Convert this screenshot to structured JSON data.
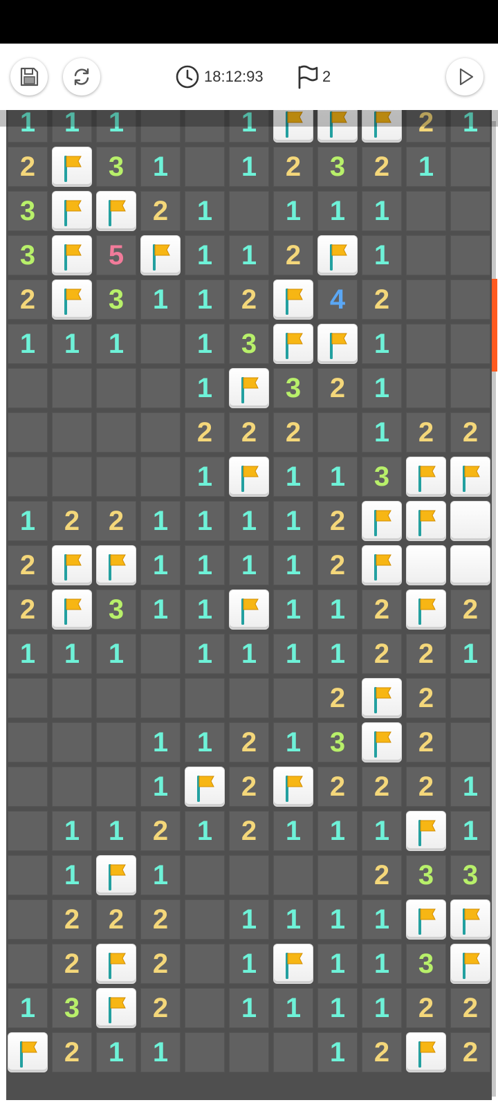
{
  "toolbar": {
    "save_icon": "save-icon",
    "restart_icon": "restart-icon",
    "timer_icon": "clock-icon",
    "timer_value": "18:12:93",
    "flags_icon": "flag-outline-icon",
    "flags_count": "2",
    "play_icon": "play-icon"
  },
  "colors": {
    "1": "#6ef2d8",
    "2": "#f4d77a",
    "3": "#b8f06a",
    "4": "#5aa7f5",
    "5": "#f27b9a",
    "flag": "#f7b614",
    "pole": "#23a0a0",
    "scroll_thumb": "#ff5a1f"
  },
  "board": {
    "legend": "digits 1-5 = revealed number, F = flagged cell, C = covered cell, . = empty revealed cell",
    "rows": [
      "111..1FFF21",
      "2F31.12321.",
      "3FF21.111..",
      "3F5F112F1..",
      "2F3112F42..",
      "111.13FF1..",
      "....1F321..",
      "....222.122",
      "....1F113FF",
      "12211112FFC",
      "2FF11112FCC",
      "2F311F112F2",
      "111.1111221",
      ".......2F2.",
      "...11213F2.",
      "...1F2F2221",
      ".11212111F1",
      ".1F1....233",
      ".222.1111FF",
      ".2F2.1F113F",
      "13F2.111122",
      "F211...12F2"
    ]
  }
}
